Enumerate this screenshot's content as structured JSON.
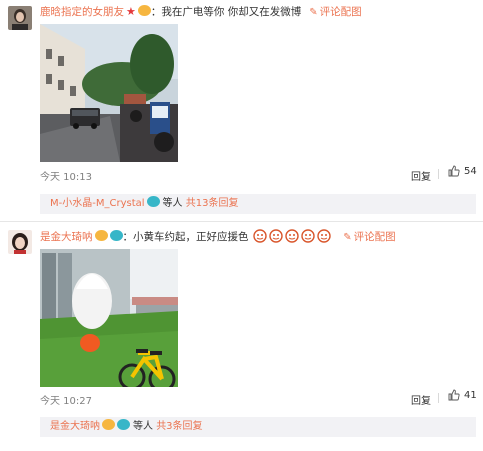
{
  "comments": [
    {
      "username": "鹿晗指定的女朋友",
      "colon": "：",
      "text": "我在广电等你 你却又在发微博",
      "comment_action": "评论配图",
      "time": "今天 10:13",
      "reply_label": "回复",
      "likes": "54",
      "reply_box": {
        "user": "M-小水晶-M_Crystal",
        "etc": "等人",
        "count_text": "共13条回复"
      }
    },
    {
      "username": "是金大琦呐",
      "colon": "：",
      "text": "小黄车约起，正好应援色",
      "comment_action": "评论配图",
      "time": "今天 10:27",
      "reply_label": "回复",
      "likes": "41",
      "reply_box": {
        "user": "是金大琦呐",
        "etc": "等人",
        "count_text": "共3条回复"
      }
    }
  ],
  "colors": {
    "accent": "#eb7350",
    "reply_bg": "#f2f2f5",
    "time_gray": "#808080"
  },
  "icons": [
    "star-icon",
    "vip-badge-icon",
    "pen-icon",
    "thumbs-up-icon",
    "cyan-badge-icon",
    "emoji-icon"
  ]
}
